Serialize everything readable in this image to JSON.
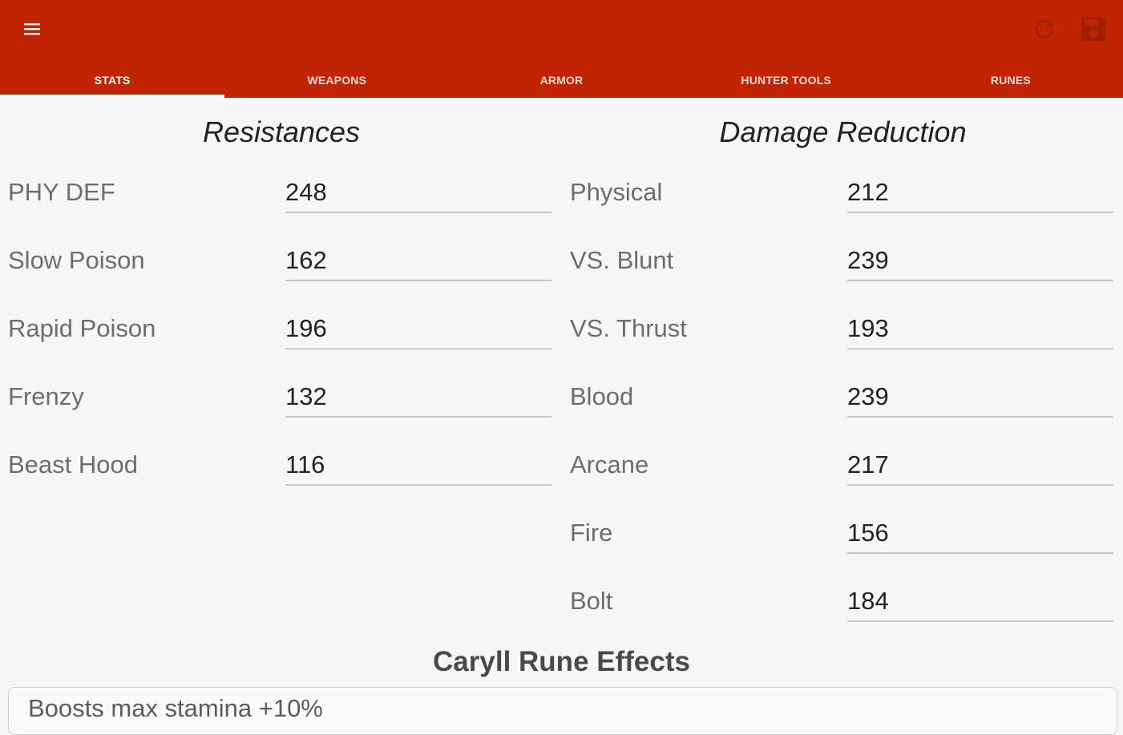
{
  "appbar": {
    "background_color": "#c02400",
    "menu_icon": "menu-icon",
    "refresh_icon": "refresh-icon",
    "save_icon": "save-icon"
  },
  "tabs": [
    {
      "label": "STATS",
      "active": true
    },
    {
      "label": "WEAPONS",
      "active": false
    },
    {
      "label": "ARMOR",
      "active": false
    },
    {
      "label": "HUNTER TOOLS",
      "active": false
    },
    {
      "label": "RUNES",
      "active": false
    }
  ],
  "resistances": {
    "title": "Resistances",
    "rows": [
      {
        "label": "PHY DEF",
        "value": "248"
      },
      {
        "label": "Slow Poison",
        "value": "162"
      },
      {
        "label": "Rapid Poison",
        "value": "196"
      },
      {
        "label": "Frenzy",
        "value": "132"
      },
      {
        "label": "Beast Hood",
        "value": "116"
      }
    ]
  },
  "damage_reduction": {
    "title": "Damage Reduction",
    "rows": [
      {
        "label": "Physical",
        "value": "212"
      },
      {
        "label": "VS. Blunt",
        "value": "239"
      },
      {
        "label": "VS. Thrust",
        "value": "193"
      },
      {
        "label": "Blood",
        "value": "239"
      },
      {
        "label": "Arcane",
        "value": "217"
      },
      {
        "label": "Fire",
        "value": "156"
      },
      {
        "label": "Bolt",
        "value": "184"
      }
    ]
  },
  "caryll": {
    "title": "Caryll Rune Effects",
    "effects": [
      "Boosts max stamina +10%"
    ]
  }
}
